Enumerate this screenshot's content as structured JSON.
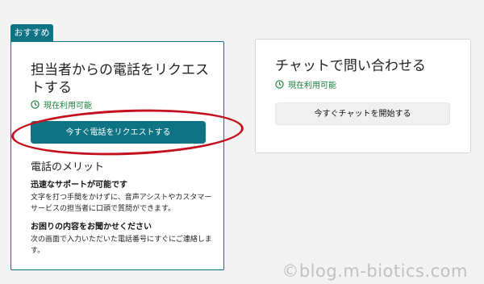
{
  "badge": "おすすめ",
  "left_card": {
    "title": "担当者からの電話をリクエストする",
    "availability": "現在利用可能",
    "button": "今すぐ電話をリクエストする",
    "merit_title": "電話のメリット",
    "benefits": [
      {
        "heading": "迅速なサポートが可能です",
        "text": "文字を打つ手間をかけずに、音声アシストやカスタマーサービスの担当者に口頭で質問ができます。"
      },
      {
        "heading": "お困りの内容をお聞かせください",
        "text": "次の画面で入力いただいた電話番号にすぐにご連絡します。"
      }
    ]
  },
  "right_card": {
    "title": "チャットで問い合わせる",
    "availability": "現在利用可能",
    "button": "今すぐチャットを開始する"
  },
  "watermark": "©blog.m-biotics.com",
  "colors": {
    "accent": "#0e7383",
    "available": "#1a7f3b",
    "highlight": "#c4101d"
  },
  "icons": [
    "clock-icon"
  ]
}
